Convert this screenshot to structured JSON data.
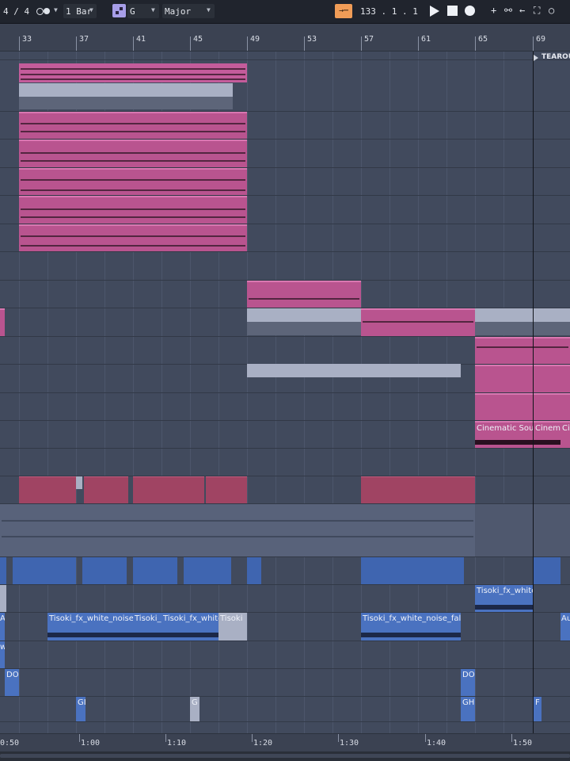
{
  "toolbar": {
    "time_signature": "4 / 4",
    "quantize": "1 Bar",
    "scale_root": "G",
    "scale_mode": "Major",
    "position": "133 .   1 .   1"
  },
  "ruler": {
    "bars": [
      "33",
      "37",
      "41",
      "45",
      "49",
      "53",
      "57",
      "61",
      "65",
      "69"
    ]
  },
  "locator": {
    "name": "TEAROU"
  },
  "clips": {
    "cinematic_a": "Cinematic Soun",
    "cinematic_b": "Cinema",
    "cinematic_c": "Ci",
    "tisoki_fx_top": "Tisoki_fx_white",
    "tisoki_noise_1": "Tisoki_fx_white_noise",
    "tisoki_noise_2": "Tisoki_",
    "tisoki_noise_3": "Tisoki_fx_white",
    "tisoki_noise_4": "Tisoki",
    "tisoki_noise_fall": "Tisoki_fx_white_noise_fall",
    "edge_a": "A",
    "edge_au": "Au",
    "edge_w": "w",
    "dol_1": "DOI",
    "dol_2": "DOI",
    "g_1": "GI",
    "g_2": "G",
    "gh": "GH",
    "f": "F"
  },
  "time_ruler": {
    "labels": [
      "0:50",
      "1:00",
      "1:10",
      "1:20",
      "1:30",
      "1:40",
      "1:50"
    ]
  },
  "colors": {
    "pink": "#b9548f",
    "blue": "#3f65b0",
    "red": "#a04463",
    "grey": "#a9b0c4",
    "transport_accent": "#f09c57",
    "scale_accent": "#a79ee8"
  }
}
